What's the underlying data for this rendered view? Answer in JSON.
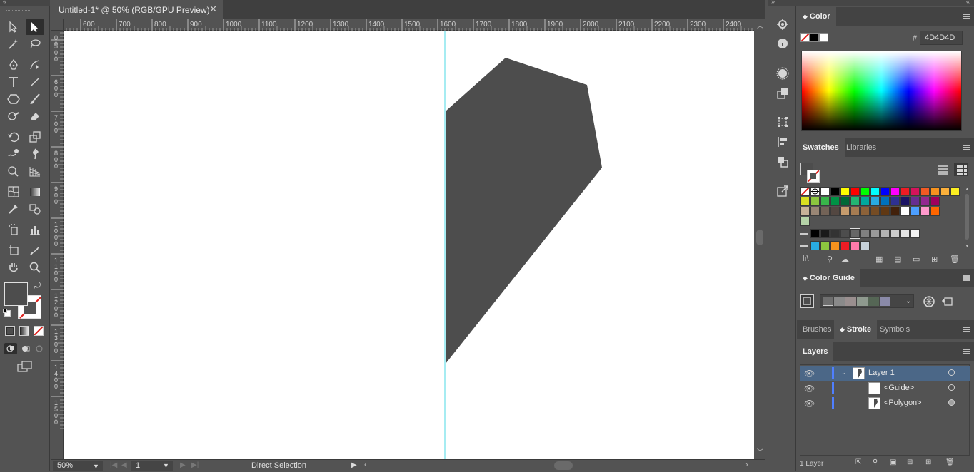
{
  "document": {
    "tab_title": "Untitled-1* @ 50% (RGB/GPU Preview)",
    "close_glyph": "✕"
  },
  "ruler": {
    "top_labels": [
      "600",
      "700",
      "800",
      "900",
      "1000",
      "1100",
      "1200",
      "1300",
      "1400",
      "1500",
      "1600",
      "1700",
      "1800",
      "1900",
      "2000",
      "2100",
      "2200",
      "2300",
      "2400"
    ],
    "left_labels": [
      [
        "0",
        "0"
      ],
      [
        "5",
        "0",
        "0"
      ],
      [
        "6",
        "0",
        "0"
      ],
      [
        "7",
        "0",
        "0"
      ],
      [
        "8",
        "0",
        "0"
      ],
      [
        "9",
        "0",
        "0"
      ],
      [
        "1",
        "0",
        "0",
        "0"
      ],
      [
        "1",
        "1",
        "0",
        "0"
      ],
      [
        "1",
        "2",
        "0",
        "0"
      ],
      [
        "1",
        "3",
        "0",
        "0"
      ],
      [
        "1",
        "4",
        "0",
        "0"
      ],
      [
        "1",
        "5",
        "0",
        "0"
      ]
    ]
  },
  "status": {
    "zoom": "50%",
    "page": "1",
    "mode": "Direct Selection"
  },
  "color_panel": {
    "title": "Color",
    "hex_symbol": "#",
    "hex_value": "4D4D4D"
  },
  "swatch_tabs": [
    "Swatches",
    "Libraries"
  ],
  "swatch_rows": [
    [
      "#ffffff",
      "#000000",
      "#ffff00",
      "#ff0000",
      "#00ff00",
      "#00ffff",
      "#0000ff",
      "#ff00ff",
      "#ed1c24",
      "#d4145a",
      "#f15a24",
      "#f7931e",
      "#fbb03b",
      "#fcee21"
    ],
    [
      "#d9e021",
      "#8cc63f",
      "#39b54a",
      "#009245",
      "#006837",
      "#22b573",
      "#00a99d",
      "#29abe2",
      "#0071bc",
      "#2e3192",
      "#1b1464",
      "#662d91",
      "#93278f",
      "#9e005d"
    ],
    [
      "#c7b299",
      "#998675",
      "#736357",
      "#534741",
      "#c69c6d",
      "#a67c52",
      "#8c6239",
      "#754c24",
      "#603813",
      "#42210b",
      "#ffffff",
      "#4d9fff",
      "#ff99cc",
      "#ff6600"
    ]
  ],
  "swatch_grays": [
    "#000000",
    "#1a1a1a",
    "#333333",
    "#4d4d4d",
    "#666666",
    "#808080",
    "#999999",
    "#b3b3b3",
    "#cccccc",
    "#e6e6e6",
    "#f2f2f2"
  ],
  "swatch_brights": [
    "#29abe2",
    "#8cc63f",
    "#f7931e",
    "#ed1c24",
    "#ff7bac",
    "#c7d1da"
  ],
  "color_guide": {
    "title": "Color Guide",
    "chips": [
      "#6f6f6f",
      "#8a8a8a",
      "#9a8f8f",
      "#8f9a8f",
      "#556655",
      "#8a8aa8"
    ]
  },
  "stroke_tabs": [
    "Brushes",
    "Stroke",
    "Symbols"
  ],
  "layers": {
    "title": "Layers",
    "rows": [
      {
        "name": "Layer 1",
        "selected": true
      },
      {
        "name": "<Guide>",
        "selected": false
      },
      {
        "name": "<Polygon>",
        "selected": false
      }
    ],
    "footer": "1 Layer"
  },
  "fill_color": "#4d4d4d",
  "guide_color": "#4dd9e6"
}
